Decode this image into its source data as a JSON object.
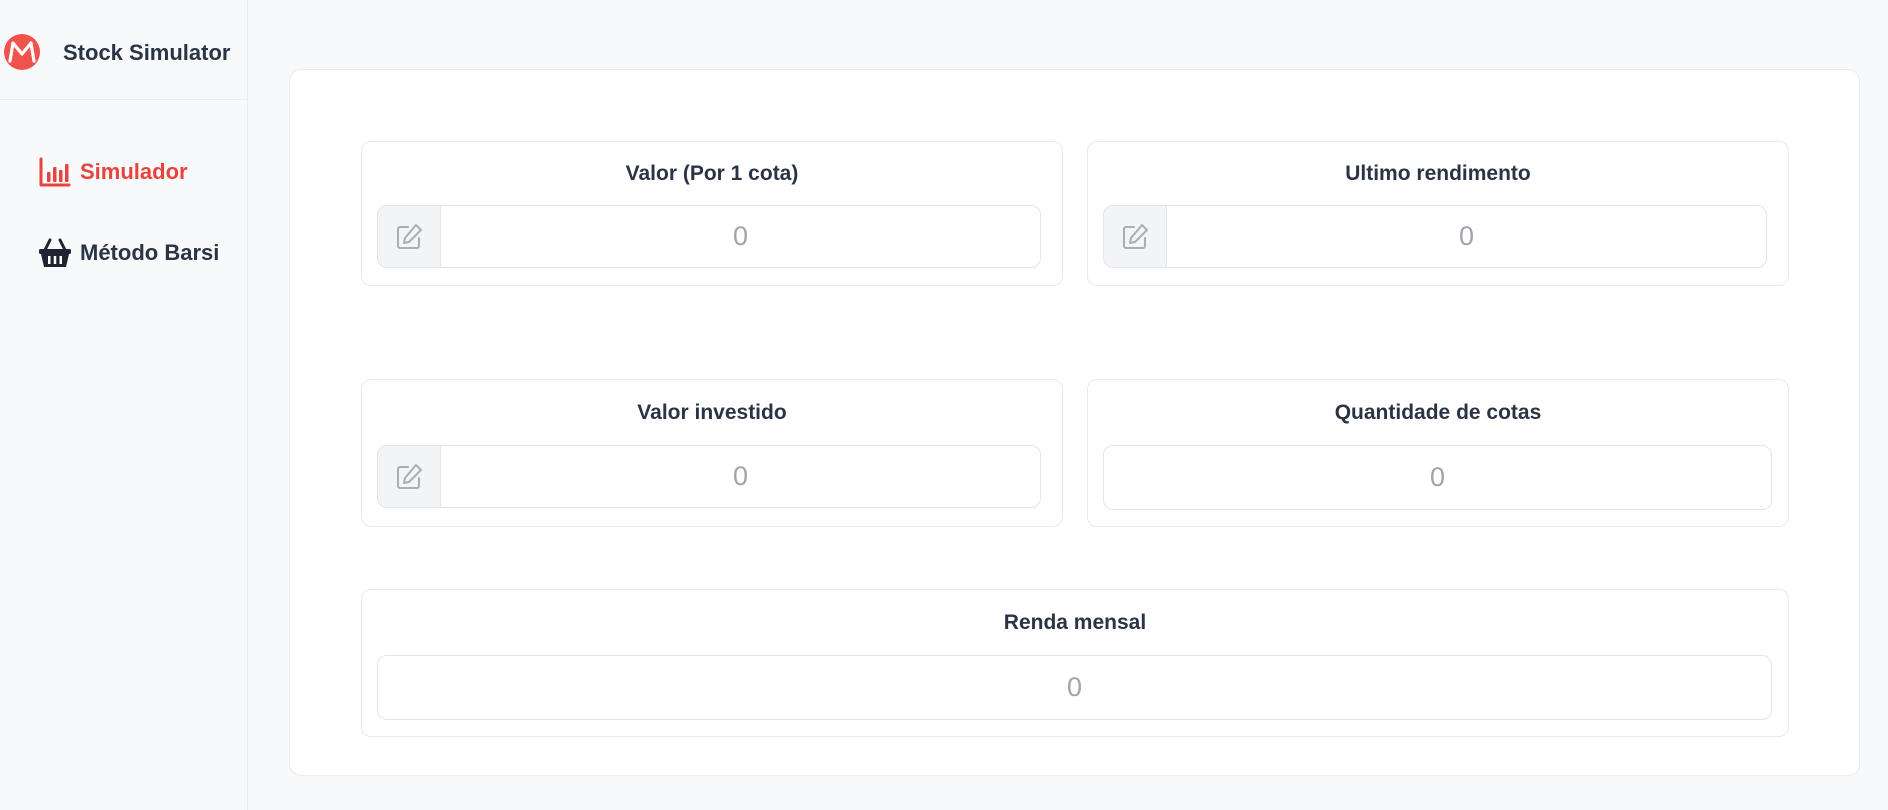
{
  "app": {
    "title": "Stock Simulator",
    "accent_color": "#e8443f",
    "logo_icon": "logo-m-icon"
  },
  "sidebar": {
    "items": [
      {
        "label": "Simulador",
        "icon": "bar-chart-icon",
        "active": true
      },
      {
        "label": "Método Barsi",
        "icon": "basket-icon",
        "active": false
      }
    ]
  },
  "fields": {
    "valor_cota": {
      "label": "Valor (Por 1 cota)",
      "value": "0",
      "icon": "edit-icon"
    },
    "ultimo_rendimento": {
      "label": "Ultimo rendimento",
      "value": "0",
      "icon": "edit-icon"
    },
    "valor_investido": {
      "label": "Valor investido",
      "value": "0",
      "icon": "edit-icon"
    },
    "quantidade_cotas": {
      "label": "Quantidade de cotas",
      "value": "0"
    },
    "renda_mensal": {
      "label": "Renda mensal",
      "value": "0"
    }
  }
}
